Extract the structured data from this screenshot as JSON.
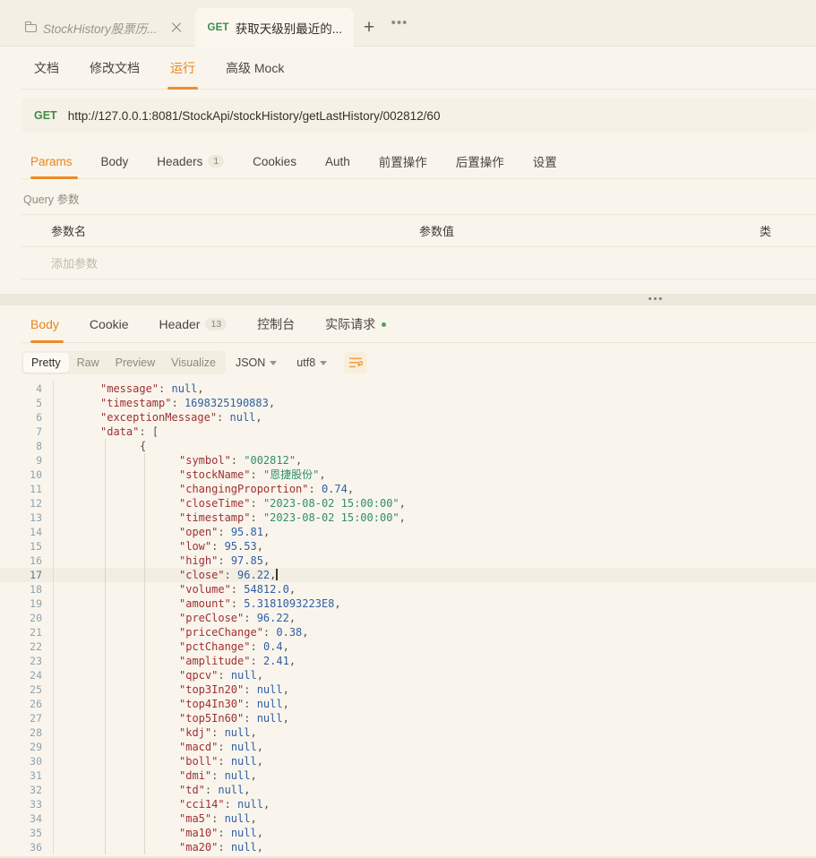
{
  "window": {
    "tabs": [
      {
        "title": "StockHistory股票历...",
        "icon": "folder-icon",
        "active": false,
        "closable": true
      },
      {
        "method": "GET",
        "title": "获取天级别最近的...",
        "active": true
      }
    ],
    "new_tab_label": "+",
    "more_label": "•••"
  },
  "doc_tabs": [
    {
      "label": "文档",
      "active": false
    },
    {
      "label": "修改文档",
      "active": false
    },
    {
      "label": "运行",
      "active": true
    },
    {
      "label": "高级 Mock",
      "active": false
    }
  ],
  "request": {
    "method": "GET",
    "url": "http://127.0.0.1:8081/StockApi/stockHistory/getLastHistory/002812/60",
    "tabs": [
      {
        "label": "Params",
        "badge": "",
        "active": true
      },
      {
        "label": "Body",
        "badge": "",
        "active": false
      },
      {
        "label": "Headers",
        "badge": "1",
        "active": false
      },
      {
        "label": "Cookies",
        "badge": "",
        "active": false
      },
      {
        "label": "Auth",
        "badge": "",
        "active": false
      },
      {
        "label": "前置操作",
        "badge": "",
        "active": false
      },
      {
        "label": "后置操作",
        "badge": "",
        "active": false
      },
      {
        "label": "设置",
        "badge": "",
        "active": false
      }
    ],
    "query_section_label": "Query 参数",
    "table": {
      "headers": [
        "参数名",
        "参数值",
        "类"
      ],
      "add_row_placeholder": "添加参数"
    }
  },
  "response": {
    "tabs": [
      {
        "label": "Body",
        "badge": "",
        "dot": false,
        "active": true
      },
      {
        "label": "Cookie",
        "badge": "",
        "dot": false,
        "active": false
      },
      {
        "label": "Header",
        "badge": "13",
        "dot": false,
        "active": false
      },
      {
        "label": "控制台",
        "badge": "",
        "dot": false,
        "active": false
      },
      {
        "label": "实际请求",
        "badge": "",
        "dot": true,
        "active": false
      }
    ],
    "viewer": {
      "modes": [
        {
          "label": "Pretty",
          "active": true
        },
        {
          "label": "Raw",
          "active": false
        },
        {
          "label": "Preview",
          "active": false
        },
        {
          "label": "Visualize",
          "active": false
        }
      ],
      "format": "JSON",
      "encoding": "utf8",
      "wrap_icon": "wrap-text-icon"
    },
    "body_lines": [
      {
        "num": 4,
        "indent": 1,
        "text": "\"message\": null,"
      },
      {
        "num": 5,
        "indent": 1,
        "text": "\"timestamp\": 1698325190883,"
      },
      {
        "num": 6,
        "indent": 1,
        "text": "\"exceptionMessage\": null,"
      },
      {
        "num": 7,
        "indent": 1,
        "text": "\"data\": ["
      },
      {
        "num": 8,
        "indent": 2,
        "text": "{"
      },
      {
        "num": 9,
        "indent": 3,
        "text": "\"symbol\": \"002812\","
      },
      {
        "num": 10,
        "indent": 3,
        "text": "\"stockName\": \"恩捷股份\","
      },
      {
        "num": 11,
        "indent": 3,
        "text": "\"changingProportion\": 0.74,"
      },
      {
        "num": 12,
        "indent": 3,
        "text": "\"closeTime\": \"2023-08-02 15:00:00\","
      },
      {
        "num": 13,
        "indent": 3,
        "text": "\"timestamp\": \"2023-08-02 15:00:00\","
      },
      {
        "num": 14,
        "indent": 3,
        "text": "\"open\": 95.81,"
      },
      {
        "num": 15,
        "indent": 3,
        "text": "\"low\": 95.53,"
      },
      {
        "num": 16,
        "indent": 3,
        "text": "\"high\": 97.85,"
      },
      {
        "num": 17,
        "indent": 3,
        "text": "\"close\": 96.22,",
        "current": true
      },
      {
        "num": 18,
        "indent": 3,
        "text": "\"volume\": 54812.0,"
      },
      {
        "num": 19,
        "indent": 3,
        "text": "\"amount\": 5.3181093223E8,"
      },
      {
        "num": 20,
        "indent": 3,
        "text": "\"preClose\": 96.22,"
      },
      {
        "num": 21,
        "indent": 3,
        "text": "\"priceChange\": 0.38,"
      },
      {
        "num": 22,
        "indent": 3,
        "text": "\"pctChange\": 0.4,"
      },
      {
        "num": 23,
        "indent": 3,
        "text": "\"amplitude\": 2.41,"
      },
      {
        "num": 24,
        "indent": 3,
        "text": "\"qpcv\": null,"
      },
      {
        "num": 25,
        "indent": 3,
        "text": "\"top3In20\": null,"
      },
      {
        "num": 26,
        "indent": 3,
        "text": "\"top4In30\": null,"
      },
      {
        "num": 27,
        "indent": 3,
        "text": "\"top5In60\": null,"
      },
      {
        "num": 28,
        "indent": 3,
        "text": "\"kdj\": null,"
      },
      {
        "num": 29,
        "indent": 3,
        "text": "\"macd\": null,"
      },
      {
        "num": 30,
        "indent": 3,
        "text": "\"boll\": null,"
      },
      {
        "num": 31,
        "indent": 3,
        "text": "\"dmi\": null,"
      },
      {
        "num": 32,
        "indent": 3,
        "text": "\"td\": null,"
      },
      {
        "num": 33,
        "indent": 3,
        "text": "\"cci14\": null,"
      },
      {
        "num": 34,
        "indent": 3,
        "text": "\"ma5\": null,"
      },
      {
        "num": 35,
        "indent": 3,
        "text": "\"ma10\": null,"
      },
      {
        "num": 36,
        "indent": 3,
        "text": "\"ma20\": null,"
      }
    ]
  },
  "colors": {
    "accent": "#ef8b28",
    "method_get": "#3d8b48",
    "page_bg": "#faf5ec",
    "json_key": "#9d2f33",
    "json_string": "#2e8f6b",
    "json_number": "#2e5fa3"
  }
}
